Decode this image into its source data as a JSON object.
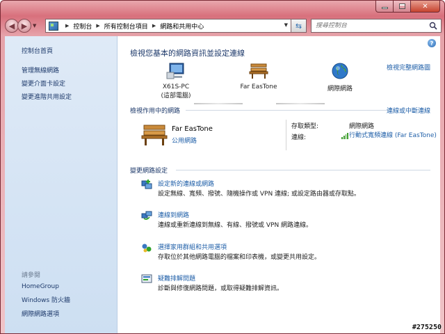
{
  "navigation": {
    "breadcrumbs": [
      "控制台",
      "所有控制台項目",
      "網路和共用中心"
    ],
    "search_placeholder": "搜尋控制台"
  },
  "sidebar": {
    "home": "控制台首頁",
    "tasks": [
      {
        "label": "管理無線網路"
      },
      {
        "label": "變更介面卡設定"
      },
      {
        "label": "變更進階共用設定"
      }
    ],
    "see_also_title": "請參閱",
    "see_also": [
      {
        "label": "HomeGroup"
      },
      {
        "label": "Windows 防火牆"
      },
      {
        "label": "網際網路選項"
      }
    ]
  },
  "main": {
    "title": "檢視您基本的網路資訊並設定連線",
    "full_map_link": "檢視完整網路圖",
    "map": {
      "computer_name": "X61S-PC",
      "computer_sub": "(這部電腦)",
      "network_name": "Far EasTone",
      "internet": "網際網路"
    },
    "active_networks": {
      "heading": "檢視作用中的網路",
      "connect_link": "連線或中斷連線",
      "network_name": "Far EasTone",
      "network_type": "公用網路",
      "access_type_label": "存取類型:",
      "access_type_value": "網際網路",
      "connections_label": "連線:",
      "connection_value": "行動式寬頻連線 (Far EasTone)"
    },
    "settings": {
      "heading": "變更網路設定",
      "tasks": [
        {
          "link": "設定新的連線或網路",
          "desc": "設定無線、寬頻、撥號、隨機操作或 VPN 連線; 或設定路由器或存取點。",
          "icon": "new-connection-icon"
        },
        {
          "link": "連線到網路",
          "desc": "連線或重新連線到無線、有線、撥號或 VPN 網路連線。",
          "icon": "connect-network-icon"
        },
        {
          "link": "選擇家用群組和共用選項",
          "desc": "存取位於其他網路電腦的檔案和印表機，或變更共用設定。",
          "icon": "homegroup-icon"
        },
        {
          "link": "疑難排解問題",
          "desc": "診斷與修復網路問題，或取得疑難排解資訊。",
          "icon": "troubleshoot-icon"
        }
      ]
    }
  },
  "watermark": "#275250"
}
